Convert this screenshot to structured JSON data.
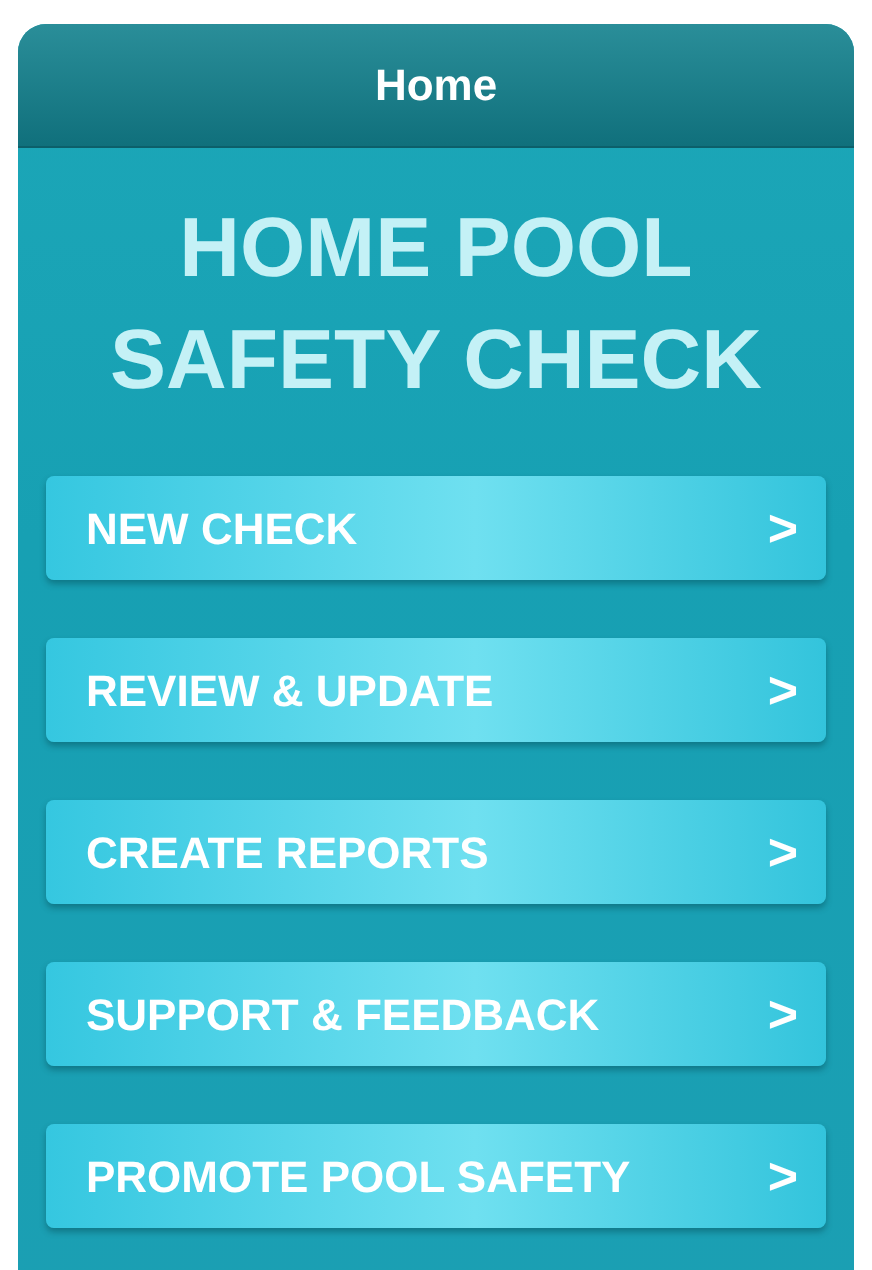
{
  "header": {
    "title": "Home"
  },
  "title_lines": [
    "HOME POOL",
    "SAFETY CHECK"
  ],
  "menu": [
    {
      "label": "NEW CHECK",
      "arrow": ">"
    },
    {
      "label": "REVIEW & UPDATE",
      "arrow": ">"
    },
    {
      "label": "CREATE REPORTS",
      "arrow": ">"
    },
    {
      "label": "SUPPORT & FEEDBACK",
      "arrow": ">"
    },
    {
      "label": "PROMOTE POOL SAFETY",
      "arrow": ">"
    }
  ]
}
